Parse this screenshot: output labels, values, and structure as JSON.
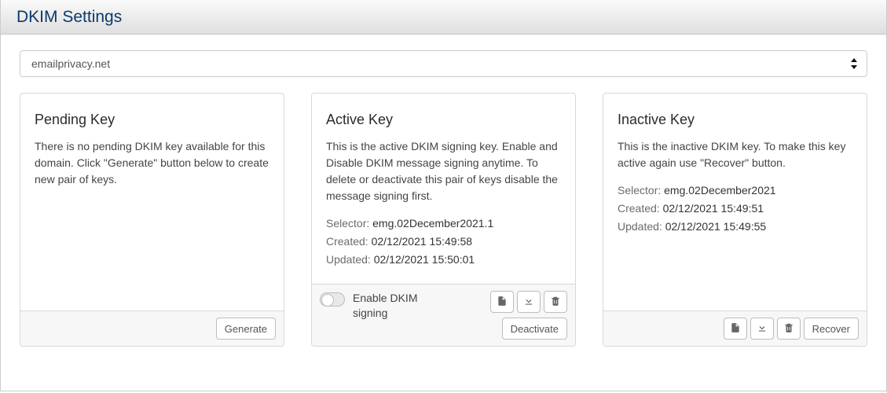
{
  "header": {
    "title": "DKIM Settings"
  },
  "domain_select": {
    "value": "emailprivacy.net"
  },
  "pending": {
    "title": "Pending Key",
    "desc": "There is no pending DKIM key available for this domain. Click \"Generate\" button below to create new pair of keys.",
    "generate_label": "Generate"
  },
  "active": {
    "title": "Active Key",
    "desc": "This is the active DKIM signing key. Enable and Disable DKIM message signing anytime. To delete or deactivate this pair of keys disable the message signing first.",
    "selector_label": "Selector:",
    "selector_value": "emg.02December2021.1",
    "created_label": "Created:",
    "created_value": "02/12/2021 15:49:58",
    "updated_label": "Updated:",
    "updated_value": "02/12/2021 15:50:01",
    "toggle_label": "Enable DKIM signing",
    "deactivate_label": "Deactivate"
  },
  "inactive": {
    "title": "Inactive Key",
    "desc": "This is the inactive DKIM key. To make this key active again use \"Recover\" button.",
    "selector_label": "Selector:",
    "selector_value": "emg.02December2021",
    "created_label": "Created:",
    "created_value": "02/12/2021 15:49:51",
    "updated_label": "Updated:",
    "updated_value": "02/12/2021 15:49:55",
    "recover_label": "Recover"
  }
}
